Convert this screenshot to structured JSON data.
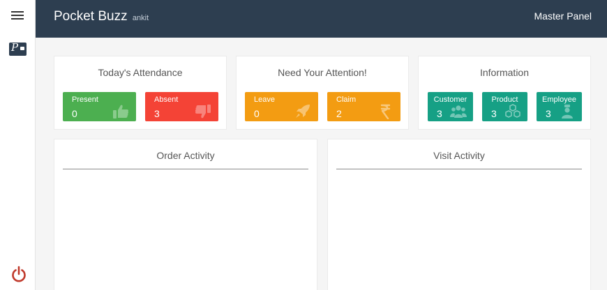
{
  "app": {
    "title": "Pocket Buzz",
    "user": "ankit",
    "panel": "Master Panel"
  },
  "sidebar": {
    "icons": [
      "menu-icon",
      "pocket-logo-icon",
      "power-icon"
    ],
    "power_color": "#c0392b"
  },
  "colors": {
    "header": "#2d3e50",
    "green": "#4caf50",
    "red": "#f44336",
    "orange": "#f39c12",
    "teal": "#16a085"
  },
  "attendance": {
    "title": "Today's Attendance",
    "tiles": [
      {
        "label": "Present",
        "value": "0",
        "icon": "thumbs-up-icon"
      },
      {
        "label": "Absent",
        "value": "3",
        "icon": "thumbs-down-icon"
      }
    ]
  },
  "attention": {
    "title": "Need Your Attention!",
    "tiles": [
      {
        "label": "Leave",
        "value": "0",
        "icon": "rocket-icon"
      },
      {
        "label": "Claim",
        "value": "2",
        "icon": "rupee-icon"
      }
    ]
  },
  "information": {
    "title": "Information",
    "tiles": [
      {
        "label": "Customer",
        "value": "3",
        "icon": "users-icon"
      },
      {
        "label": "Product",
        "value": "3",
        "icon": "cubes-icon"
      },
      {
        "label": "Employee",
        "value": "3",
        "icon": "employee-icon"
      }
    ]
  },
  "activity": {
    "order": {
      "title": "Order Activity"
    },
    "visit": {
      "title": "Visit Activity"
    }
  }
}
